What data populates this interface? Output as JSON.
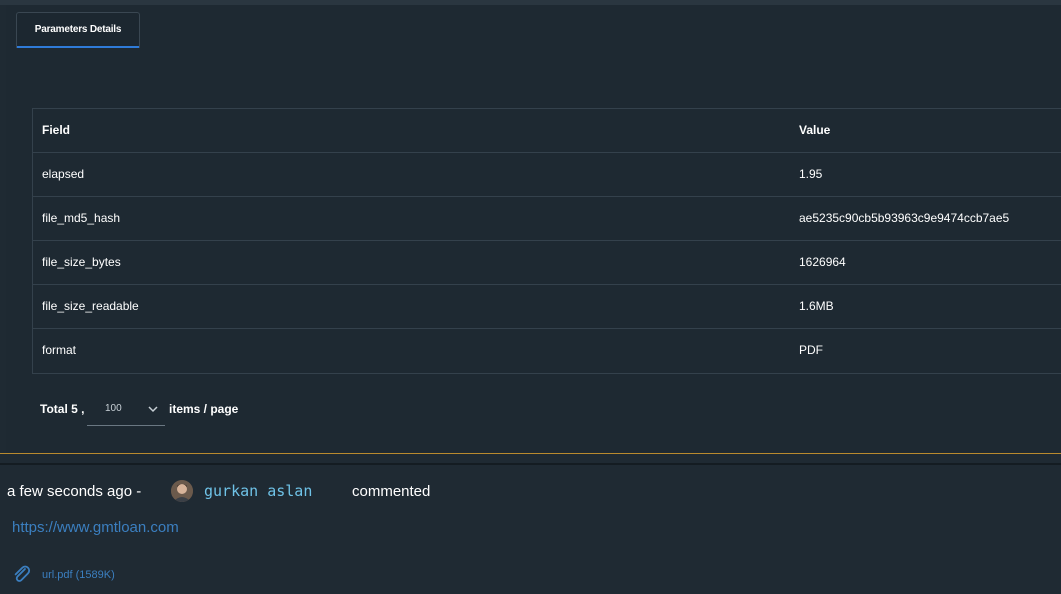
{
  "tabs": [
    {
      "label": "Parameters Details",
      "active": true
    }
  ],
  "table": {
    "headers": {
      "field": "Field",
      "value": "Value"
    },
    "rows": [
      {
        "field": "elapsed",
        "value": "1.95"
      },
      {
        "field": "file_md5_hash",
        "value": "ae5235c90cb5b93963c9e9474ccb7ae5"
      },
      {
        "field": "file_size_bytes",
        "value": "1626964"
      },
      {
        "field": "file_size_readable",
        "value": "1.6MB"
      },
      {
        "field": "format",
        "value": "PDF"
      }
    ]
  },
  "pagination": {
    "total_label": "Total 5 ,",
    "page_size": "100",
    "suffix": "items / page"
  },
  "comment": {
    "time": "a few seconds ago -",
    "author": "gurkan aslan",
    "action": "commented",
    "link": "https://www.gmtloan.com",
    "attachment": "url.pdf (1589K)"
  },
  "colors": {
    "background": "#1f2a33",
    "accent": "#2f7bd8",
    "link": "#3b7fc0",
    "author": "#6fc3e8",
    "divider": "#b98a2e"
  },
  "icons": {
    "pager_dropdown": "chevron-down-icon",
    "attachment": "paperclip-icon",
    "avatar": "user-avatar"
  }
}
